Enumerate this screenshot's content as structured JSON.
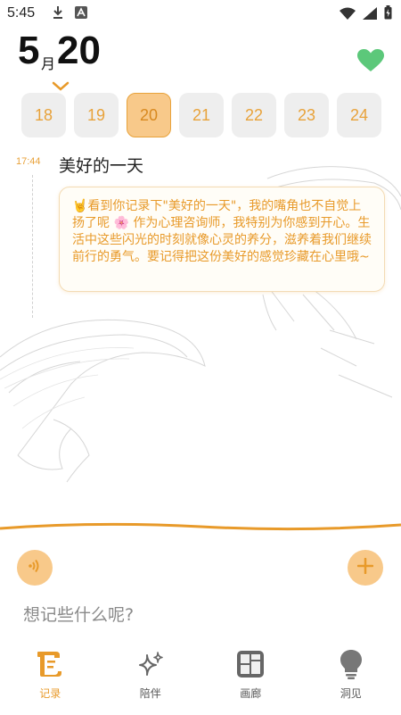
{
  "status_bar": {
    "time": "5:45",
    "icons": [
      "download-icon",
      "a-icon",
      "wifi-icon",
      "signal-icon",
      "battery-icon"
    ]
  },
  "header": {
    "month": "5",
    "month_unit": "月",
    "date": "20",
    "icons": [
      "chevron-down-icon",
      "heart-icon"
    ]
  },
  "day_strip": {
    "days": [
      "18",
      "19",
      "20",
      "21",
      "22",
      "23",
      "24"
    ],
    "selected": "20"
  },
  "entry": {
    "time": "17:44",
    "title": "美好的一天",
    "reply": "🤘看到你记录下\"美好的一天\"，我的嘴角也不自觉上扬了呢 🌸 作为心理咨询师，我特别为你感到开心。生活中这些闪光的时刻就像心灵的养分，滋养着我们继续前行的勇气。要记得把这份美好的感觉珍藏在心里哦~"
  },
  "composer": {
    "placeholder": "想记些什么呢?",
    "icons": [
      "voice-icon",
      "plus-icon"
    ]
  },
  "nav": {
    "items": [
      {
        "label": "记录",
        "icon": "journal-icon",
        "active": true
      },
      {
        "label": "陪伴",
        "icon": "sparkle-icon",
        "active": false
      },
      {
        "label": "画廊",
        "icon": "gallery-icon",
        "active": false
      },
      {
        "label": "洞见",
        "icon": "lightbulb-icon",
        "active": false
      }
    ]
  },
  "colors": {
    "accent": "#e89a2a",
    "accent_light": "#f8c98a",
    "heart": "#5cc87a",
    "chip_bg": "#eeeeee"
  }
}
